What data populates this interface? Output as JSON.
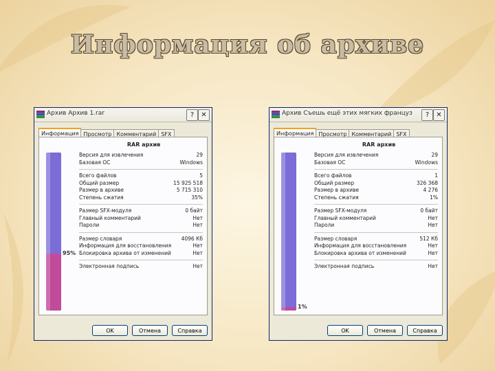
{
  "slide_title": "Информация об архиве",
  "windows": [
    {
      "title": "Архив Архив 1.rar",
      "tabs": [
        "Информация",
        "Просмотр",
        "Комментарий",
        "SFX"
      ],
      "panel_heading": "RAR архив",
      "percent_label": "95%",
      "percent_fill": 0.36,
      "rows_group1": [
        {
          "label": "Версия для извлечения",
          "value": "29"
        },
        {
          "label": "Базовая ОС",
          "value": "Windows"
        }
      ],
      "rows_group2": [
        {
          "label": "Всего файлов",
          "value": "5"
        },
        {
          "label": "Общий размер",
          "value": "15 925 518"
        },
        {
          "label": "Размер в архиве",
          "value": "5 715 310"
        },
        {
          "label": "Степень сжатия",
          "value": "35%"
        }
      ],
      "rows_group3": [
        {
          "label": "Размер SFX-модуля",
          "value": "0 байт"
        },
        {
          "label": "Главный комментарий",
          "value": "Нет"
        },
        {
          "label": "Пароли",
          "value": "Нет"
        }
      ],
      "rows_group4": [
        {
          "label": "Размер словаря",
          "value": "4096 Кб"
        },
        {
          "label": "Информация для восстановления",
          "value": "Нет"
        },
        {
          "label": "Блокировка архива от изменений",
          "value": "Нет"
        }
      ],
      "rows_group5": [
        {
          "label": "Электронная подпись",
          "value": "Нет"
        }
      ],
      "buttons": {
        "ok": "OK",
        "cancel": "Отмена",
        "help": "Справка"
      }
    },
    {
      "title": "Архив Съешь ещё этих мягких французск...",
      "tabs": [
        "Информация",
        "Просмотр",
        "Комментарий",
        "SFX"
      ],
      "panel_heading": "RAR архив",
      "percent_label": "1%",
      "percent_fill": 0.02,
      "rows_group1": [
        {
          "label": "Версия для извлечения",
          "value": "29"
        },
        {
          "label": "Базовая ОС",
          "value": "Windows"
        }
      ],
      "rows_group2": [
        {
          "label": "Всего файлов",
          "value": "1"
        },
        {
          "label": "Общий размер",
          "value": "326 368"
        },
        {
          "label": "Размер в архиве",
          "value": "4 276"
        },
        {
          "label": "Степень сжатия",
          "value": "1%"
        }
      ],
      "rows_group3": [
        {
          "label": "Размер SFX-модуля",
          "value": "0 байт"
        },
        {
          "label": "Главный комментарий",
          "value": "Нет"
        },
        {
          "label": "Пароли",
          "value": "Нет"
        }
      ],
      "rows_group4": [
        {
          "label": "Размер словаря",
          "value": "512 Кб"
        },
        {
          "label": "Информация для восстановления",
          "value": "Нет"
        },
        {
          "label": "Блокировка архива от изменений",
          "value": "Нет"
        }
      ],
      "rows_group5": [
        {
          "label": "Электронная подпись",
          "value": "Нет"
        }
      ],
      "buttons": {
        "ok": "OK",
        "cancel": "Отмена",
        "help": "Справка"
      }
    }
  ],
  "colors": {
    "bar_empty": "#7b6cd6",
    "bar_fill": "#c24a9a",
    "accent_tab": "#f3a31b"
  },
  "icons": {
    "app": "winrar-icon",
    "help": "help-icon",
    "close": "close-icon"
  }
}
